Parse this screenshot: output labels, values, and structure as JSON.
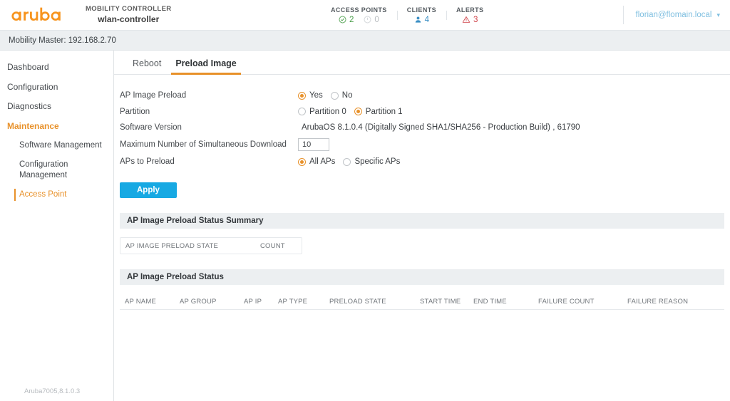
{
  "header": {
    "brand": "aruba",
    "product_kicker": "MOBILITY CONTROLLER",
    "product_name": "wlan-controller",
    "stats": [
      {
        "label": "ACCESS POINTS",
        "values": [
          {
            "icon": "check-circle-icon",
            "value": "2",
            "state": "up"
          },
          {
            "icon": "circle-icon",
            "value": "0",
            "state": "down"
          }
        ]
      },
      {
        "label": "CLIENTS",
        "values": [
          {
            "icon": "user-icon",
            "value": "4",
            "state": "clients"
          }
        ]
      },
      {
        "label": "ALERTS",
        "values": [
          {
            "icon": "warning-triangle-icon",
            "value": "3",
            "state": "alerts"
          }
        ]
      }
    ],
    "user": "florian@flomain.local",
    "user_caret_icon": "chevron-down-icon"
  },
  "context_bar": {
    "text": "Mobility Master: 192.168.2.70"
  },
  "sidebar": {
    "items": [
      {
        "label": "Dashboard",
        "level": "top",
        "active": false
      },
      {
        "label": "Configuration",
        "level": "top",
        "active": false
      },
      {
        "label": "Diagnostics",
        "level": "top",
        "active": false
      },
      {
        "label": "Maintenance",
        "level": "top",
        "active": true
      },
      {
        "label": "Software Management",
        "level": "sub",
        "active": false
      },
      {
        "label": "Configuration Management",
        "level": "sub",
        "active": false
      },
      {
        "label": "Access Point",
        "level": "sub",
        "active": true
      }
    ],
    "version_footer": "Aruba7005,8.1.0.3"
  },
  "main": {
    "tabs": [
      {
        "label": "Reboot",
        "active": false
      },
      {
        "label": "Preload Image",
        "active": true
      }
    ],
    "form": {
      "ap_image_preload": {
        "label": "AP Image Preload",
        "options": [
          {
            "label": "Yes",
            "checked": true
          },
          {
            "label": "No",
            "checked": false
          }
        ]
      },
      "partition": {
        "label": "Partition",
        "options": [
          {
            "label": "Partition 0",
            "checked": false
          },
          {
            "label": "Partition 1",
            "checked": true
          }
        ]
      },
      "software_version": {
        "label": "Software Version",
        "value": "ArubaOS 8.1.0.4 (Digitally Signed SHA1/SHA256 - Production Build) , 61790"
      },
      "max_simultaneous_download": {
        "label": "Maximum Number of Simultaneous Download",
        "value": "10"
      },
      "aps_to_preload": {
        "label": "APs to Preload",
        "options": [
          {
            "label": "All APs",
            "checked": true
          },
          {
            "label": "Specific APs",
            "checked": false
          }
        ]
      },
      "apply_label": "Apply"
    },
    "summary_panel": {
      "title": "AP Image Preload Status Summary",
      "columns": [
        "AP IMAGE PRELOAD STATE",
        "COUNT"
      ],
      "rows": []
    },
    "status_panel": {
      "title": "AP Image Preload Status",
      "columns": [
        "AP NAME",
        "AP GROUP",
        "AP IP",
        "AP TYPE",
        "PRELOAD STATE",
        "START TIME",
        "END TIME",
        "FAILURE COUNT",
        "FAILURE REASON"
      ],
      "rows": []
    }
  },
  "colors": {
    "brand_orange": "#e8912a",
    "accent_blue": "#17a9e3",
    "panel_gray": "#eceff1",
    "status_up": "#4a9e4a",
    "status_down": "#b8bcc0",
    "status_clients": "#3b8fc4",
    "status_alerts": "#d0454c"
  }
}
